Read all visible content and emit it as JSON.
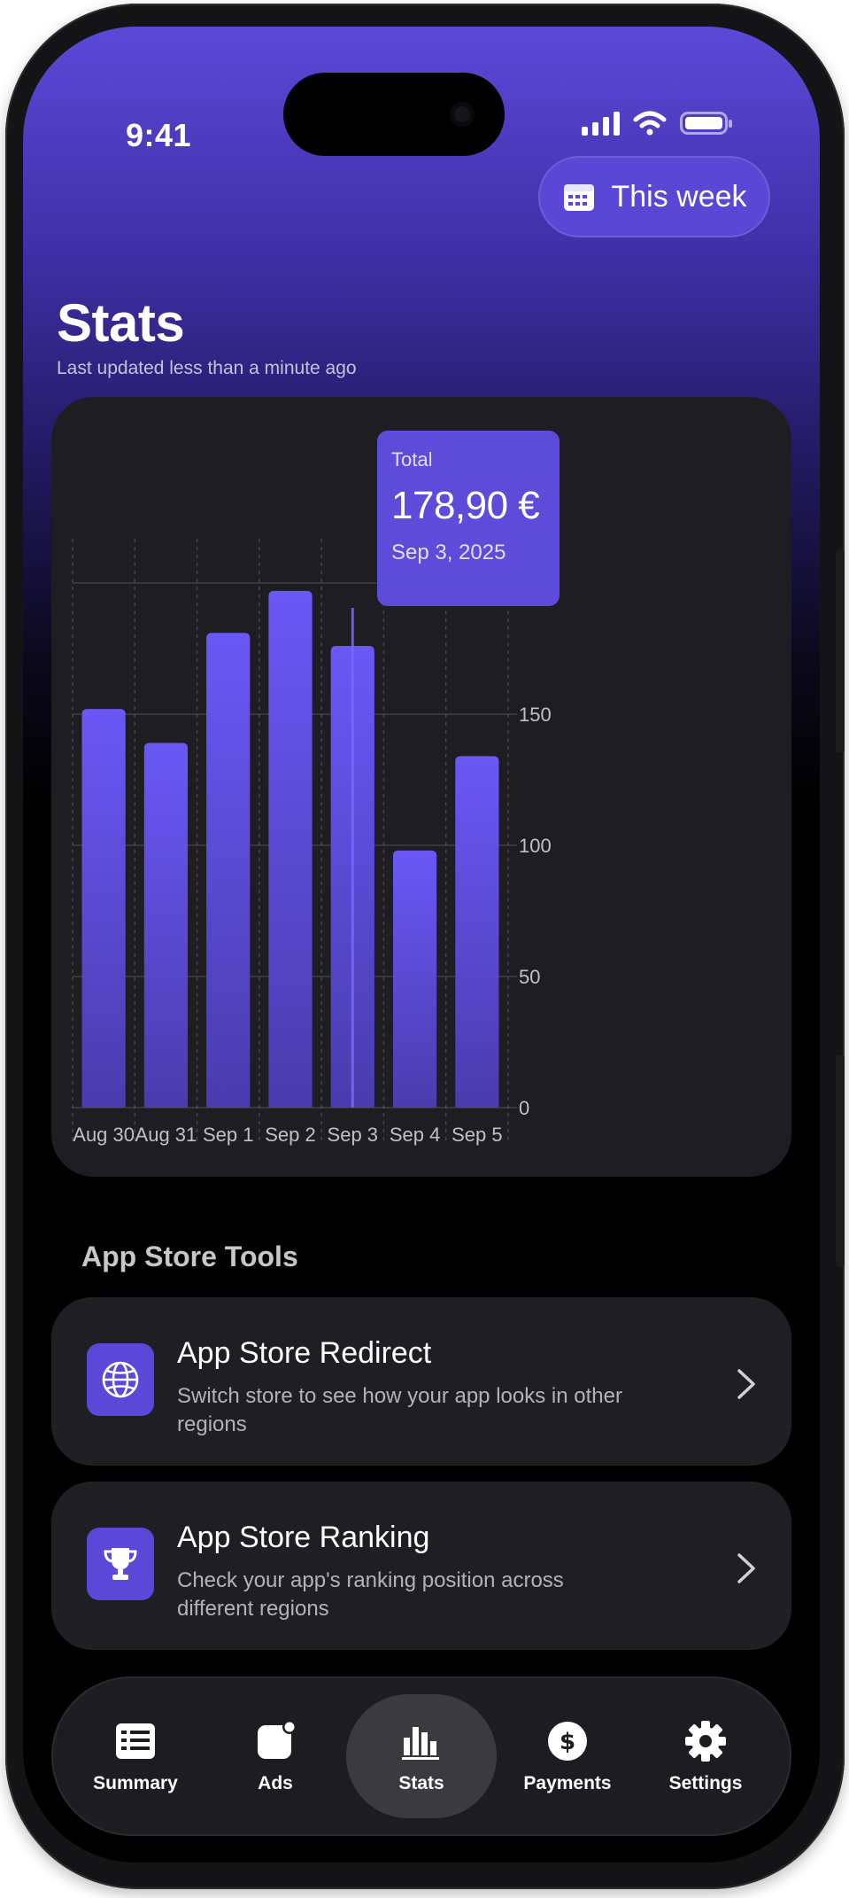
{
  "status_bar": {
    "time": "9:41"
  },
  "header": {
    "period_label": "This week",
    "title": "Stats",
    "subtitle": "Last updated less than a minute ago"
  },
  "tooltip": {
    "label": "Total",
    "value": "178,90 €",
    "date": "Sep 3, 2025"
  },
  "chart_data": {
    "type": "bar",
    "categories": [
      "Aug 30",
      "Aug 31",
      "Sep 1",
      "Sep 2",
      "Sep 3",
      "Sep 4",
      "Sep 5"
    ],
    "values": [
      152,
      139,
      181,
      197,
      176,
      98,
      134
    ],
    "y_ticks": [
      "200",
      "150",
      "100",
      "50",
      "0"
    ],
    "ylim": [
      0,
      200
    ],
    "highlighted_category": "Sep 3",
    "grid": true,
    "color": "#6a58f6"
  },
  "tools": {
    "section_title": "App Store Tools",
    "items": [
      {
        "title": "App Store Redirect",
        "description": "Switch store to see how your app looks in other regions",
        "icon": "globe-icon"
      },
      {
        "title": "App Store Ranking",
        "description": "Check your app's ranking position across different regions",
        "icon": "trophy-icon"
      }
    ]
  },
  "tab_bar": {
    "tabs": [
      {
        "label": "Summary",
        "icon": "summary-list-icon"
      },
      {
        "label": "Ads",
        "icon": "ads-badge-icon"
      },
      {
        "label": "Stats",
        "icon": "bar-chart-icon",
        "active": true
      },
      {
        "label": "Payments",
        "icon": "dollar-icon"
      },
      {
        "label": "Settings",
        "icon": "gear-icon"
      }
    ]
  },
  "colors": {
    "accent": "#5b48d8",
    "card": "#1e1e22",
    "bar": "#6a58f6"
  }
}
